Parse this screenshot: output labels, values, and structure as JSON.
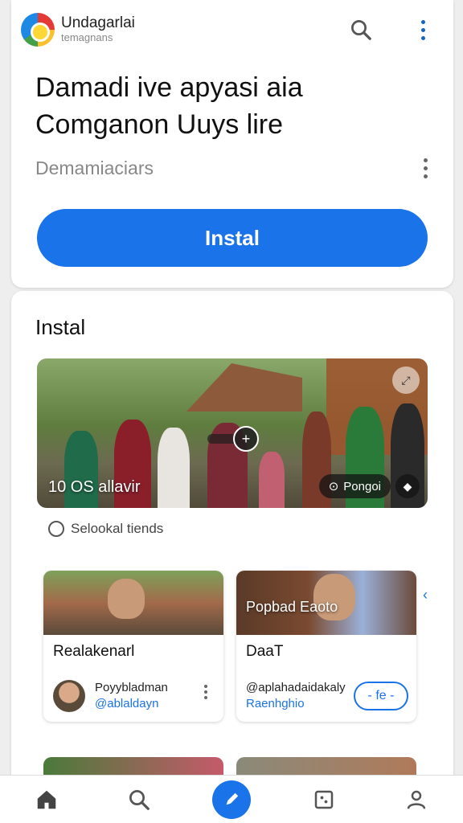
{
  "header": {
    "app_name": "Undagarlai",
    "app_subtitle": "temagnans"
  },
  "listing": {
    "headline": "Damadi ive apyasi aia Comganon Uuys lire",
    "developer": "Demamiaciars",
    "install_label": "Instal"
  },
  "section": {
    "title": "Instal",
    "hero": {
      "caption": "10 OS allavir",
      "chip_label": "Pongoi"
    },
    "tag_label": "Selookal tiends"
  },
  "cards": [
    {
      "image_text": "",
      "title": "Realakenarl",
      "meta_line1": "Poyybladman",
      "meta_line2": "@ablaldayn"
    },
    {
      "image_text": "Popbad Eaoto",
      "title": "DaaT",
      "meta_line1": "@aplahadaidakaly",
      "meta_line2": "Raenhghio",
      "button_label": "- fe -"
    }
  ],
  "colors": {
    "accent": "#1a73e8",
    "background": "#eeeeee"
  },
  "icons": {
    "top": [
      "search-icon",
      "more-vertical-icon"
    ],
    "nav": [
      "home-icon",
      "search-icon",
      "compose-icon",
      "apps-icon",
      "profile-icon"
    ]
  }
}
